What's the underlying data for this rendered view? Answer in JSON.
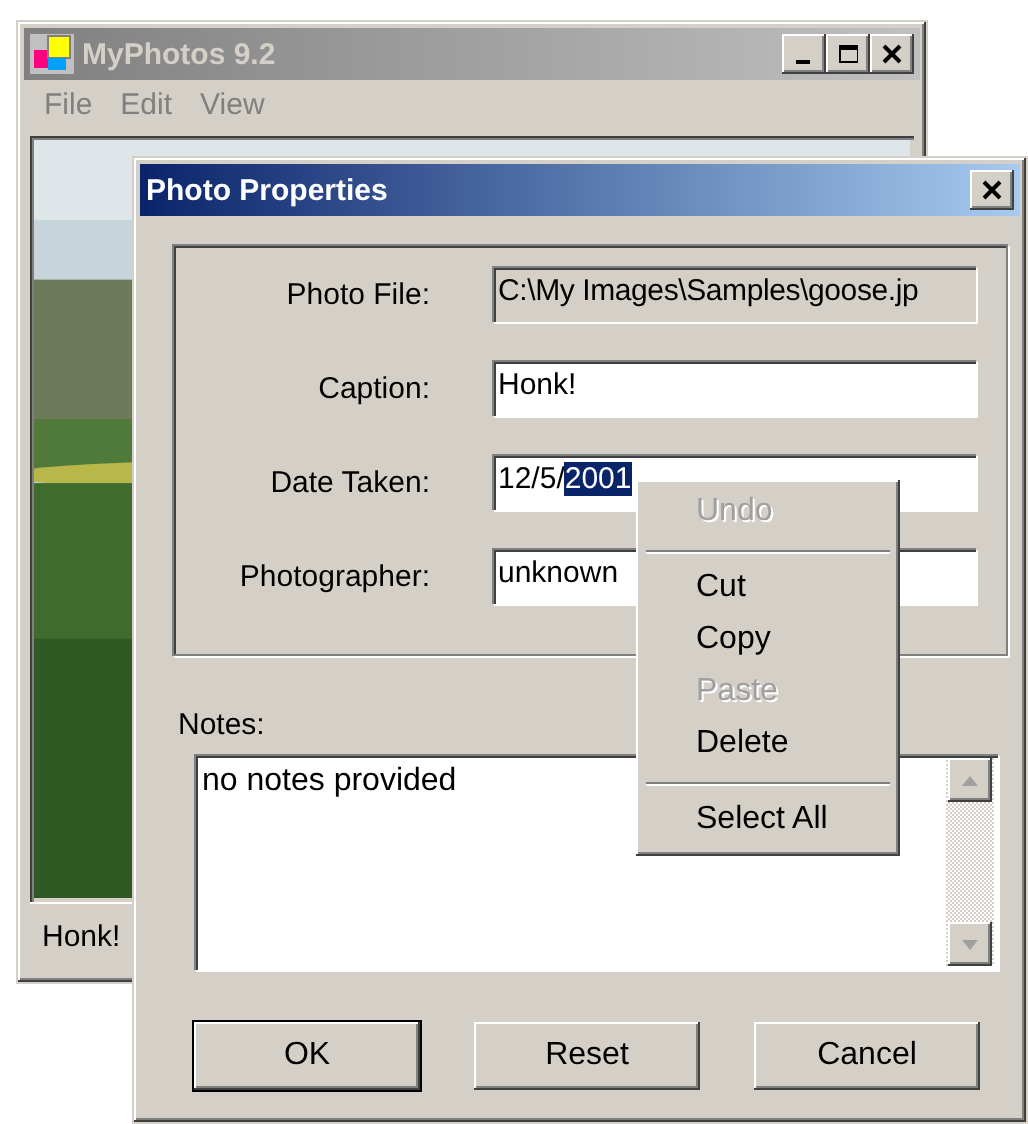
{
  "main_window": {
    "title": "MyPhotos 9.2",
    "menu": [
      {
        "label": "File"
      },
      {
        "label": "Edit"
      },
      {
        "label": "View"
      }
    ],
    "status_bar": "Honk!"
  },
  "dialog": {
    "title": "Photo Properties",
    "fields": [
      {
        "label": "Photo File:",
        "readonly": true,
        "parts": [
          {
            "text": "C:\\My Images\\Samples\\goose.jp",
            "selected": false
          }
        ]
      },
      {
        "label": "Caption:",
        "readonly": false,
        "parts": [
          {
            "text": "Honk!",
            "selected": false
          }
        ]
      },
      {
        "label": "Date Taken:",
        "readonly": false,
        "parts": [
          {
            "text": "12/5/",
            "selected": false
          },
          {
            "text": "2001",
            "selected": true
          }
        ]
      },
      {
        "label": "Photographer:",
        "readonly": false,
        "parts": [
          {
            "text": "unknown",
            "selected": false
          }
        ]
      }
    ],
    "notes": {
      "label": "Notes:",
      "value": "no notes provided"
    },
    "buttons": [
      {
        "label": "OK",
        "default": true
      },
      {
        "label": "Reset",
        "default": false
      },
      {
        "label": "Cancel",
        "default": false
      }
    ]
  },
  "context_menu": {
    "items": [
      {
        "kind": "item",
        "label": "Undo",
        "disabled": true
      },
      {
        "kind": "separator"
      },
      {
        "kind": "item",
        "label": "Cut",
        "disabled": false
      },
      {
        "kind": "item",
        "label": "Copy",
        "disabled": false
      },
      {
        "kind": "item",
        "label": "Paste",
        "disabled": true
      },
      {
        "kind": "item",
        "label": "Delete",
        "disabled": false
      },
      {
        "kind": "separator"
      },
      {
        "kind": "item",
        "label": "Select All",
        "disabled": false
      }
    ]
  }
}
